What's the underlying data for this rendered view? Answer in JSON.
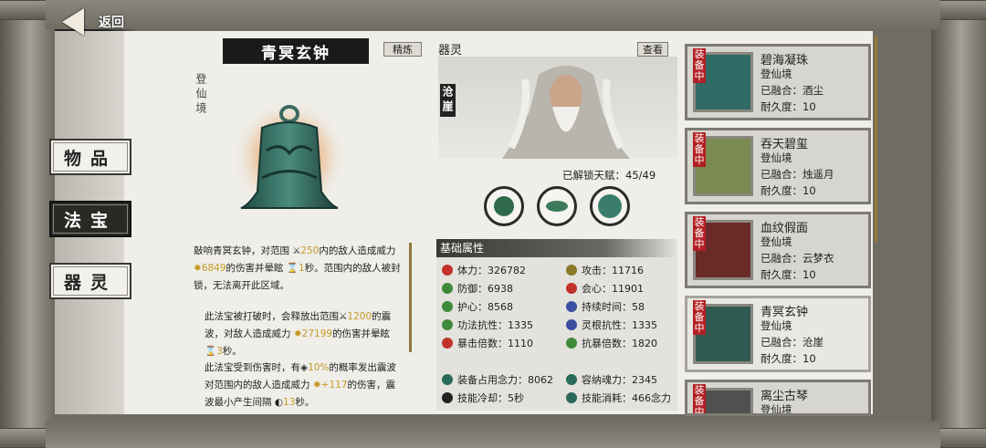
{
  "header": {
    "back_label": "返回"
  },
  "nav": {
    "tabs": [
      "物品",
      "法宝",
      "器灵"
    ],
    "active": 1
  },
  "treasure": {
    "name": "青冥玄钟",
    "refine_label": "精炼",
    "realm": "登仙境",
    "description_lines": [
      "敲响青冥玄钟，对范围",
      "250",
      "内的敌人造成威力",
      "6849",
      "的伤害并晕眩",
      "1",
      "秒。范围内的敌人被封锁，无法离开此区域。"
    ],
    "effects": [
      {
        "a": "此法宝被打破时，会释放出范围",
        "b": "1200",
        "c": "的震波，对敌人造成威力",
        "d": "27199",
        "e": "的伤害并晕眩",
        "f": "3",
        "g": "秒。"
      },
      {
        "a": "此法宝受到伤害时，有",
        "b": "10%",
        "c": "的概率发出震波对范围内的敌人造成威力",
        "d": "+117",
        "e": "的伤害，震波最小产生间隔",
        "f": "13",
        "g": "秒。"
      }
    ]
  },
  "spirit": {
    "section_title": "器灵",
    "view_label": "查看",
    "name": "沧崖",
    "unlocked_label": "已解锁天赋：",
    "unlocked_value": "45/49"
  },
  "stats": {
    "title": "基础属性",
    "left": [
      {
        "label": "体力：",
        "value": "326782",
        "icon": "heart-icon",
        "color": "#c0322a"
      },
      {
        "label": "防御：",
        "value": "6938",
        "icon": "shield-icon",
        "color": "#3f8a3a"
      },
      {
        "label": "护心：",
        "value": "8568",
        "icon": "circle-icon",
        "color": "#3f8a3a"
      },
      {
        "label": "功法抗性：",
        "value": "1335",
        "icon": "arc-icon",
        "color": "#3f8a3a"
      },
      {
        "label": "暴击倍数：",
        "value": "1110",
        "icon": "triangle-icon",
        "color": "#c0322a"
      }
    ],
    "right": [
      {
        "label": "攻击：",
        "value": "11716",
        "icon": "swords-icon",
        "color": "#8a7a2a"
      },
      {
        "label": "会心：",
        "value": "11901",
        "icon": "tri-icon",
        "color": "#c0322a"
      },
      {
        "label": "持续时间：",
        "value": "58",
        "icon": "hourglass-icon",
        "color": "#3a4fa0"
      },
      {
        "label": "灵根抗性：",
        "value": "1335",
        "icon": "arc-icon",
        "color": "#3a4fa0"
      },
      {
        "label": "抗暴倍数：",
        "value": "1820",
        "icon": "down-triangle-icon",
        "color": "#3f8a3a"
      }
    ],
    "bottom": [
      {
        "label": "装备占用念力：",
        "value": "8062",
        "icon": "eye-icon",
        "color": "#2a6a5a"
      },
      {
        "label": "容纳魂力：",
        "value": "2345",
        "icon": "swirl-icon",
        "color": "#2a6a5a"
      },
      {
        "label": "技能冷却：",
        "value": "5秒",
        "icon": "yin-yang-icon",
        "color": "#222"
      },
      {
        "label": "技能消耗：",
        "value": "466念力",
        "icon": "eye-icon",
        "color": "#2a6a5a"
      }
    ]
  },
  "equipment": [
    {
      "badge": "装备中",
      "name": "碧海凝珠",
      "realm": "登仙境",
      "fused": "已融合：",
      "fused_with": "酒尘",
      "durability": "耐久度：",
      "dur_value": "10"
    },
    {
      "badge": "装备中",
      "name": "吞天碧玺",
      "realm": "登仙境",
      "fused": "已融合：",
      "fused_with": "烛遥月",
      "durability": "耐久度：",
      "dur_value": "10"
    },
    {
      "badge": "装备中",
      "name": "血纹假面",
      "realm": "登仙境",
      "fused": "已融合：",
      "fused_with": "云梦衣",
      "durability": "耐久度：",
      "dur_value": "10"
    },
    {
      "badge": "装备中",
      "name": "青冥玄钟",
      "realm": "登仙境",
      "fused": "已融合：",
      "fused_with": "沧崖",
      "durability": "耐久度：",
      "dur_value": "10"
    },
    {
      "badge": "装备中",
      "name": "离尘古琴",
      "realm": "登仙境"
    }
  ]
}
